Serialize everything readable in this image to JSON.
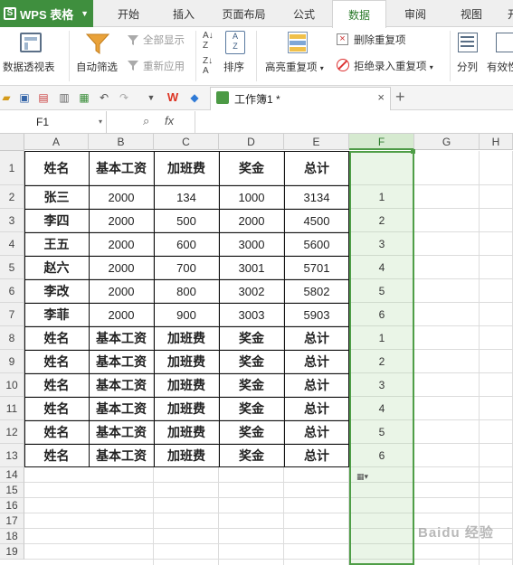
{
  "app": {
    "menu_label": "WPS 表格"
  },
  "tabs": [
    "开始",
    "插入",
    "页面布局",
    "公式",
    "数据",
    "审阅",
    "视图",
    "开"
  ],
  "active_tab": "数据",
  "ribbon": {
    "pivot": "数据透视表",
    "autofilter": "自动筛选",
    "show_all": "全部显示",
    "reapply": "重新应用",
    "sort": "排序",
    "highlight_dup": "高亮重复项",
    "remove_dup": "删除重复项",
    "reject_dup": "拒绝录入重复项",
    "split": "分列",
    "validity": "有效性"
  },
  "document": {
    "tab_title": "工作簿1 *"
  },
  "formula_bar": {
    "name_box": "F1",
    "fx": "fx",
    "formula": ""
  },
  "columns": [
    "A",
    "B",
    "C",
    "D",
    "E",
    "F",
    "G",
    "H"
  ],
  "rows": [
    "1",
    "2",
    "3",
    "4",
    "5",
    "6",
    "7",
    "8",
    "9",
    "10",
    "11",
    "12",
    "13",
    "14",
    "15",
    "16",
    "17",
    "18",
    "19"
  ],
  "table": {
    "header": [
      "姓名",
      "基本工资",
      "加班费",
      "奖金",
      "总计"
    ],
    "data": [
      [
        "张三",
        "2000",
        "134",
        "1000",
        "3134"
      ],
      [
        "李四",
        "2000",
        "500",
        "2000",
        "4500"
      ],
      [
        "王五",
        "2000",
        "600",
        "3000",
        "5600"
      ],
      [
        "赵六",
        "2000",
        "700",
        "3001",
        "5701"
      ],
      [
        "李改",
        "2000",
        "800",
        "3002",
        "5802"
      ],
      [
        "李菲",
        "2000",
        "900",
        "3003",
        "5903"
      ]
    ],
    "repeat_header_rows": 6
  },
  "column_f": [
    "",
    "1",
    "2",
    "3",
    "4",
    "5",
    "6",
    "1",
    "2",
    "3",
    "4",
    "5",
    "6"
  ],
  "watermark": "Baidu 经验"
}
